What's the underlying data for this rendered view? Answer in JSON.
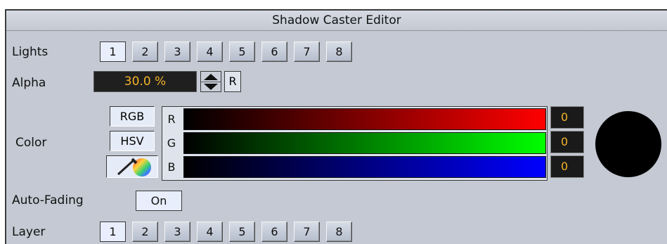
{
  "window": {
    "title": "Shadow Caster Editor"
  },
  "lights": {
    "label": "Lights",
    "buttons": [
      {
        "label": "1",
        "active": true
      },
      {
        "label": "2",
        "active": false
      },
      {
        "label": "3",
        "active": false
      },
      {
        "label": "4",
        "active": false
      },
      {
        "label": "5",
        "active": false
      },
      {
        "label": "6",
        "active": false
      },
      {
        "label": "7",
        "active": false
      },
      {
        "label": "8",
        "active": false
      }
    ]
  },
  "alpha": {
    "label": "Alpha",
    "value": "30.0 %",
    "reset_label": "R",
    "stepper_icon": "up-down-arrows-icon"
  },
  "color": {
    "label": "Color",
    "modes": [
      {
        "label": "RGB",
        "active": true
      },
      {
        "label": "HSV",
        "active": false
      }
    ],
    "picker_icon": "eyedropper-color-wheel-icon",
    "channels": [
      {
        "letter": "R",
        "value": "0",
        "gradient_to": "#ff0000"
      },
      {
        "letter": "G",
        "value": "0",
        "gradient_to": "#00ff00"
      },
      {
        "letter": "B",
        "value": "0",
        "gradient_to": "#0000ff"
      }
    ],
    "swatch_color": "#000000"
  },
  "auto_fading": {
    "label": "Auto-Fading",
    "value": "On"
  },
  "layer": {
    "label": "Layer",
    "buttons": [
      {
        "label": "1",
        "active": true
      },
      {
        "label": "2",
        "active": false
      },
      {
        "label": "3",
        "active": false
      },
      {
        "label": "4",
        "active": false
      },
      {
        "label": "5",
        "active": false
      },
      {
        "label": "6",
        "active": false
      },
      {
        "label": "7",
        "active": false
      },
      {
        "label": "8",
        "active": false
      }
    ]
  },
  "theme": {
    "panel_bg": "#c4c9d3",
    "value_text": "#f3b32a",
    "field_bg": "#1f1f1f"
  }
}
